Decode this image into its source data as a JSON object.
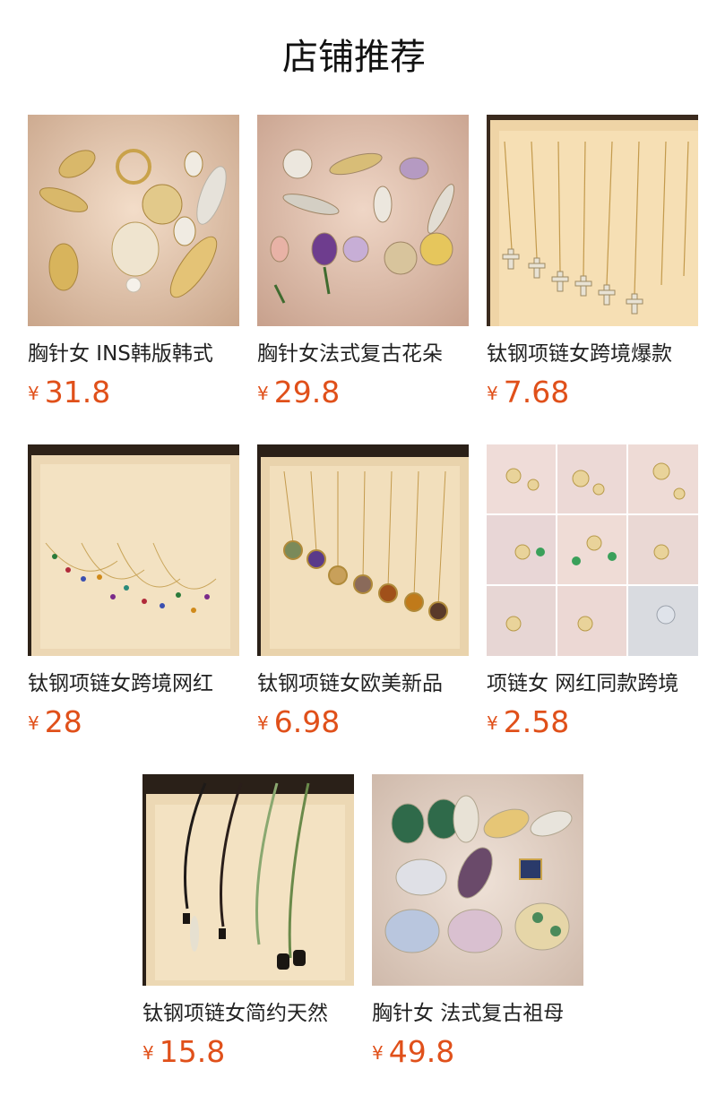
{
  "page": {
    "title": "店铺推荐"
  },
  "currency_symbol": "¥",
  "products": [
    {
      "name": "胸针女 INS韩版韩式",
      "price": "31.8",
      "image": "brooch-collection-gold-pearl"
    },
    {
      "name": "胸针女法式复古花朵",
      "price": "29.8",
      "image": "brooch-collection-flowers"
    },
    {
      "name": "钛钢项链女跨境爆款",
      "price": "7.68",
      "image": "cross-pendant-necklaces"
    },
    {
      "name": "钛钢项链女跨境网红",
      "price": "28",
      "image": "colored-gem-chain-necklaces"
    },
    {
      "name": "钛钢项链女欧美新品",
      "price": "6.98",
      "image": "gemstone-coin-pendant-necklaces"
    },
    {
      "name": "项链女 网红同款跨境",
      "price": "2.58",
      "image": "jewelry-set-grid"
    },
    {
      "name": "钛钢项链女简约天然",
      "price": "15.8",
      "image": "beaded-stone-necklaces"
    },
    {
      "name": "胸针女 法式复古祖母",
      "price": "49.8",
      "image": "butterfly-brooches"
    }
  ]
}
